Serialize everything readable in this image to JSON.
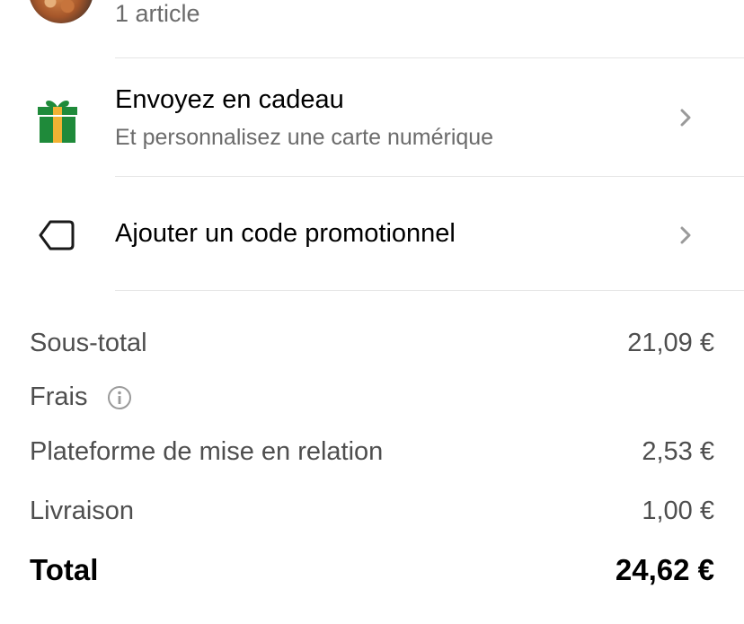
{
  "order": {
    "item_count": "1 article"
  },
  "gift": {
    "title": "Envoyez en cadeau",
    "subtitle": "Et personnalisez une carte numérique",
    "icon": "gift-icon",
    "colors": {
      "box": "#1f8a3a",
      "ribbon": "#f2b233"
    }
  },
  "promo": {
    "label": "Ajouter un code promotionnel",
    "icon": "tag-icon"
  },
  "summary": {
    "subtotal": {
      "label": "Sous-total",
      "value": "21,09 €"
    },
    "fees": {
      "label": "Frais",
      "icon": "info-icon"
    },
    "platform": {
      "label": "Plateforme de mise en relation",
      "value": "2,53 €"
    },
    "delivery": {
      "label": "Livraison",
      "value": "1,00 €"
    },
    "total": {
      "label": "Total",
      "value": "24,62 €"
    }
  }
}
